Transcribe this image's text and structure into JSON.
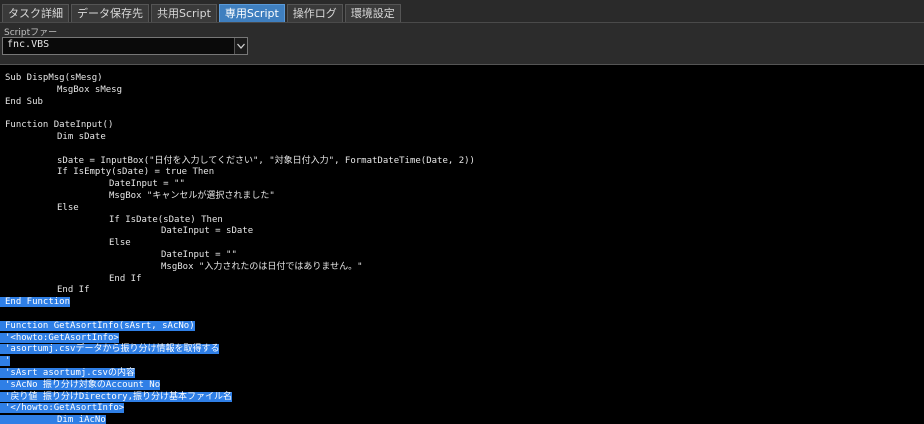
{
  "tabs": [
    {
      "label": "タスク詳細",
      "active": false
    },
    {
      "label": "データ保存先",
      "active": false
    },
    {
      "label": "共用Script",
      "active": false
    },
    {
      "label": "専用Script",
      "active": true
    },
    {
      "label": "操作ログ",
      "active": false
    },
    {
      "label": "環境設定",
      "active": false
    }
  ],
  "script_file": {
    "label": "Scriptファー",
    "value": "fnc.VBS"
  },
  "code": {
    "lines": [
      {
        "text": "Sub DispMsg(sMesg)",
        "indent": 0,
        "hl": false
      },
      {
        "text": "MsgBox sMesg",
        "indent": 1,
        "hl": false
      },
      {
        "text": "End Sub",
        "indent": 0,
        "hl": false
      },
      {
        "text": "",
        "indent": 0,
        "hl": false
      },
      {
        "text": "Function DateInput()",
        "indent": 0,
        "hl": false
      },
      {
        "text": "Dim sDate",
        "indent": 1,
        "hl": false
      },
      {
        "text": "",
        "indent": 0,
        "hl": false
      },
      {
        "text": "sDate = InputBox(\"日付を入力してください\", \"対象日付入力\", FormatDateTime(Date, 2))",
        "indent": 1,
        "hl": false
      },
      {
        "text": "If IsEmpty(sDate) = true Then",
        "indent": 1,
        "hl": false
      },
      {
        "text": "DateInput = \"\"",
        "indent": 2,
        "hl": false
      },
      {
        "text": "MsgBox \"キャンセルが選択されました\"",
        "indent": 2,
        "hl": false
      },
      {
        "text": "Else",
        "indent": 1,
        "hl": false
      },
      {
        "text": "If IsDate(sDate) Then",
        "indent": 2,
        "hl": false
      },
      {
        "text": "DateInput = sDate",
        "indent": 3,
        "hl": false
      },
      {
        "text": "Else",
        "indent": 2,
        "hl": false
      },
      {
        "text": "DateInput = \"\"",
        "indent": 3,
        "hl": false
      },
      {
        "text": "MsgBox \"入力されたのは日付ではありません。\"",
        "indent": 3,
        "hl": false
      },
      {
        "text": "End If",
        "indent": 2,
        "hl": false
      },
      {
        "text": "End If",
        "indent": 1,
        "hl": false
      },
      {
        "text": "End Function",
        "indent": 0,
        "hl": true
      },
      {
        "text": "",
        "indent": 0,
        "hl": false
      },
      {
        "text": "Function GetAsortInfo(sAsrt, sAcNo)",
        "indent": 0,
        "hl": true
      },
      {
        "text": "'<howto:GetAsortInfo>",
        "indent": 0,
        "hl": true
      },
      {
        "text": "'asortumj.csvデータから振り分け情報を取得する",
        "indent": 0,
        "hl": true
      },
      {
        "text": "'",
        "indent": 0,
        "hl": true
      },
      {
        "text": "'sAsrt asortumj.csvの内容",
        "indent": 0,
        "hl": true
      },
      {
        "text": "'sAcNo 振り分け対象のAccount No",
        "indent": 0,
        "hl": true
      },
      {
        "text": "'戻り値 振り分けDirectory,振り分け基本ファイル名",
        "indent": 0,
        "hl": true
      },
      {
        "text": "'</howto:GetAsortInfo>",
        "indent": 0,
        "hl": true
      },
      {
        "text": "Dim iAcNo",
        "indent": 1,
        "hl": true
      }
    ]
  },
  "colors": {
    "active_tab": "#3f7fbf",
    "selection": "#2f7fe6",
    "editor_bg": "#000000"
  },
  "icons": {
    "dropdown": "chevron-down-icon"
  }
}
